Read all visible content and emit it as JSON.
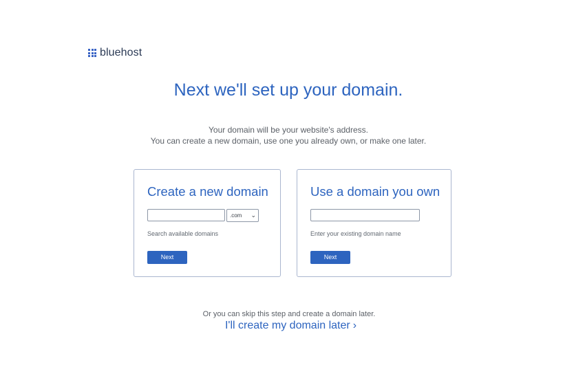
{
  "logo": {
    "text": "bluehost",
    "brand_color": "#3a64c5"
  },
  "page": {
    "title": "Next we'll set up your domain.",
    "intro_line1": "Your domain will be your website's address.",
    "intro_line2": "You can create a new domain, use one you already own, or make one later."
  },
  "cards": {
    "new": {
      "title": "Create a new domain",
      "input_value": "",
      "tld_selected": ".com",
      "hint": "Search available domains",
      "button_label": "Next"
    },
    "own": {
      "title": "Use a domain you own",
      "input_value": "",
      "hint": "Enter your existing domain name",
      "button_label": "Next"
    }
  },
  "footer": {
    "skip_text": "Or you can skip this step and create a domain later.",
    "later_link": "I'll create my domain later",
    "arrow_icon": "chevron-right-icon"
  },
  "colors": {
    "accent": "#2d64bf",
    "border": "#aab6cf",
    "text": "#5a5f66"
  }
}
